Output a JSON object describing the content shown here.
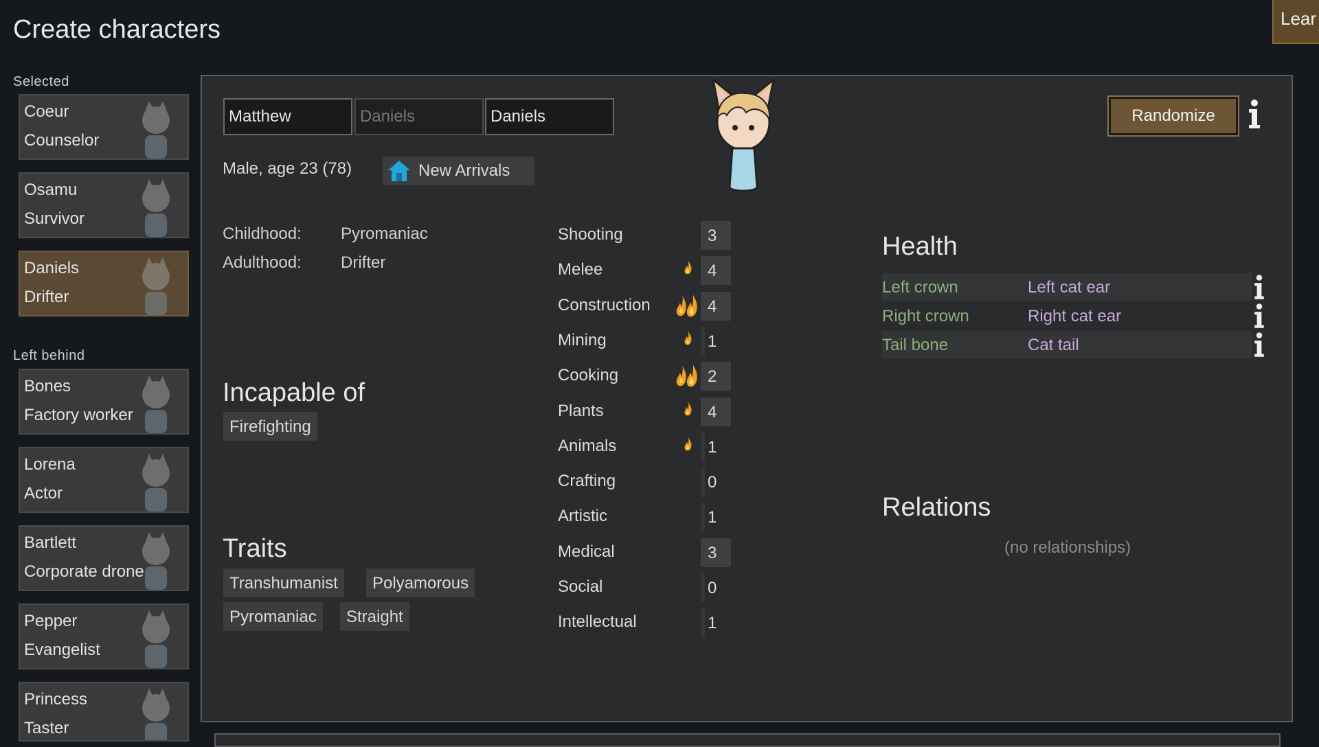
{
  "screen": {
    "title": "Create characters",
    "learn_button": "Lear"
  },
  "sidebar": {
    "selected_label": "Selected",
    "left_behind_label": "Left behind",
    "selected": [
      {
        "name": "Coeur",
        "title": "Counselor"
      },
      {
        "name": "Osamu",
        "title": "Survivor"
      },
      {
        "name": "Daniels",
        "title": "Drifter"
      }
    ],
    "left_behind": [
      {
        "name": "Bones",
        "title": "Factory worker"
      },
      {
        "name": "Lorena",
        "title": "Actor"
      },
      {
        "name": "Bartlett",
        "title": "Corporate drone"
      },
      {
        "name": "Pepper",
        "title": "Evangelist"
      },
      {
        "name": "Princess",
        "title": "Taster"
      }
    ]
  },
  "pawn": {
    "first_name": "Matthew",
    "nick_placeholder": "Daniels",
    "last_name": "Daniels",
    "randomize_label": "Randomize",
    "gender_age": "Male, age 23 (78)",
    "faction": "New Arrivals"
  },
  "backstory": {
    "childhood_label": "Childhood:",
    "childhood": "Pyromaniac",
    "adulthood_label": "Adulthood:",
    "adulthood": "Drifter"
  },
  "incapable": {
    "heading": "Incapable of",
    "items": [
      "Firefighting"
    ]
  },
  "traits": {
    "heading": "Traits",
    "items": [
      "Transhumanist",
      "Polyamorous",
      "Pyromaniac",
      "Straight"
    ]
  },
  "skills": [
    {
      "name": "Shooting",
      "level": 3,
      "passion": "none"
    },
    {
      "name": "Melee",
      "level": 4,
      "passion": "minor"
    },
    {
      "name": "Construction",
      "level": 4,
      "passion": "major"
    },
    {
      "name": "Mining",
      "level": 1,
      "passion": "minor"
    },
    {
      "name": "Cooking",
      "level": 2,
      "passion": "major"
    },
    {
      "name": "Plants",
      "level": 4,
      "passion": "minor"
    },
    {
      "name": "Animals",
      "level": 1,
      "passion": "minor"
    },
    {
      "name": "Crafting",
      "level": 0,
      "passion": "none"
    },
    {
      "name": "Artistic",
      "level": 1,
      "passion": "none"
    },
    {
      "name": "Medical",
      "level": 3,
      "passion": "none"
    },
    {
      "name": "Social",
      "level": 0,
      "passion": "none"
    },
    {
      "name": "Intellectual",
      "level": 1,
      "passion": "none"
    }
  ],
  "health": {
    "heading": "Health",
    "rows": [
      {
        "part": "Left crown",
        "condition": "Left cat ear"
      },
      {
        "part": "Right crown",
        "condition": "Right cat ear"
      },
      {
        "part": "Tail bone",
        "condition": "Cat tail"
      }
    ]
  },
  "relations": {
    "heading": "Relations",
    "empty_text": "(no relationships)"
  },
  "colors": {
    "background": "#15191d",
    "panel": "#2a2b2c",
    "selected_card": "#5a4a33",
    "button": "#6d5636",
    "body_part_text": "#8dae7b",
    "condition_text": "#c8a8e0",
    "passion_flame": "#f0a020"
  },
  "icons": {
    "faction": "house-icon",
    "info": "info-icon",
    "passion_minor": "flame-icon",
    "passion_major": "double-flame-icon"
  }
}
